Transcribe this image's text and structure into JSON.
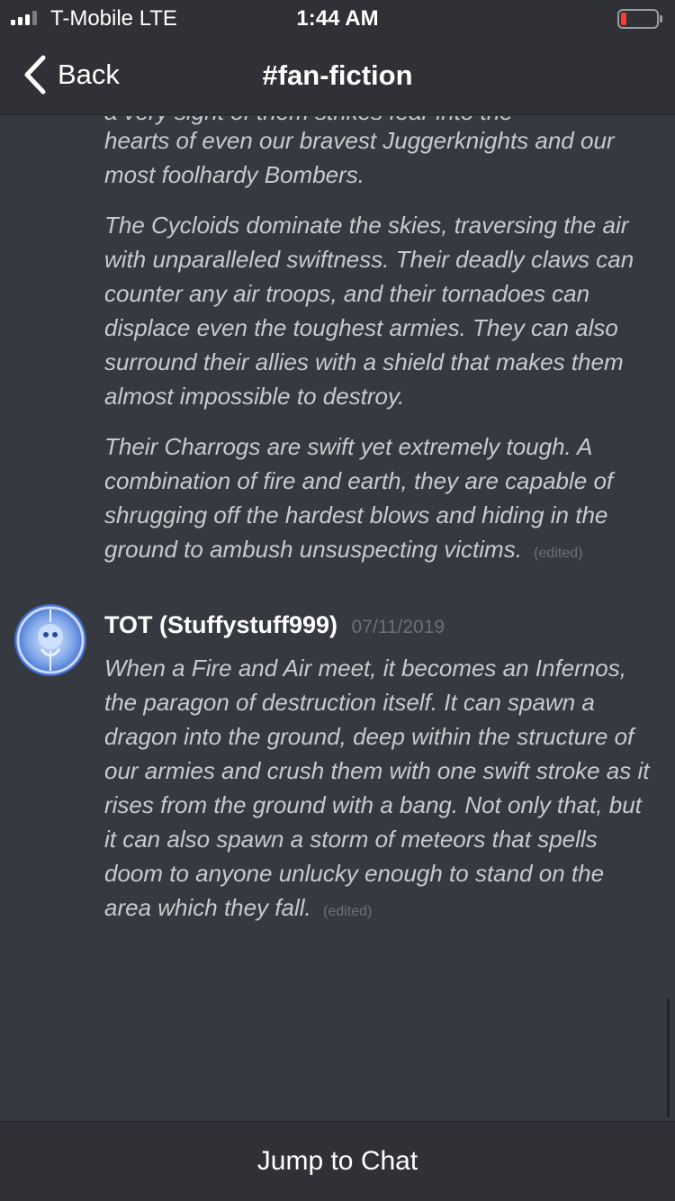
{
  "status_bar": {
    "carrier": "T-Mobile  LTE",
    "time": "1:44 AM",
    "battery_level": 0.15
  },
  "nav": {
    "back_label": "Back",
    "channel_title": "#fan-fiction"
  },
  "messages": {
    "cut_line": "a very sight of them strikes fear into the",
    "previous_paragraphs": [
      "hearts of even our bravest Juggerknights and our most foolhardy Bombers.",
      "The Cycloids dominate the skies, traversing the air with unparalleled swiftness. Their deadly claws can counter any air troops, and their tornadoes can displace even the toughest armies. They can also surround their allies with a shield that makes them almost impossible to destroy.",
      "Their Charrogs are swift yet extremely tough. A combination of fire and earth, they are capable of shrugging off the hardest blows and hiding in the ground to ambush unsuspecting victims."
    ],
    "previous_edited": "(edited)",
    "last": {
      "author": "TOT (Stuffystuff999)",
      "timestamp": "07/11/2019",
      "text": "When a Fire and Air meet, it becomes an Infernos, the paragon of destruction itself. It can spawn a dragon into the ground, deep within the structure of our armies and crush them with one swift stroke as it rises from the ground with a bang. Not only that, but it can also spawn a storm of meteors that spells doom to anyone unlucky enough to stand on the area which they fall.",
      "edited": "(edited)"
    }
  },
  "footer": {
    "jump_label": "Jump to Chat"
  },
  "colors": {
    "background": "#36393f",
    "bars": "#2f3136",
    "message_text": "#c8cacd",
    "muted": "#6d6f74",
    "battery_low": "#ff3b30"
  },
  "icons": {
    "back": "chevron-left-icon",
    "signal": "cellular-signal-icon",
    "battery": "battery-icon"
  }
}
